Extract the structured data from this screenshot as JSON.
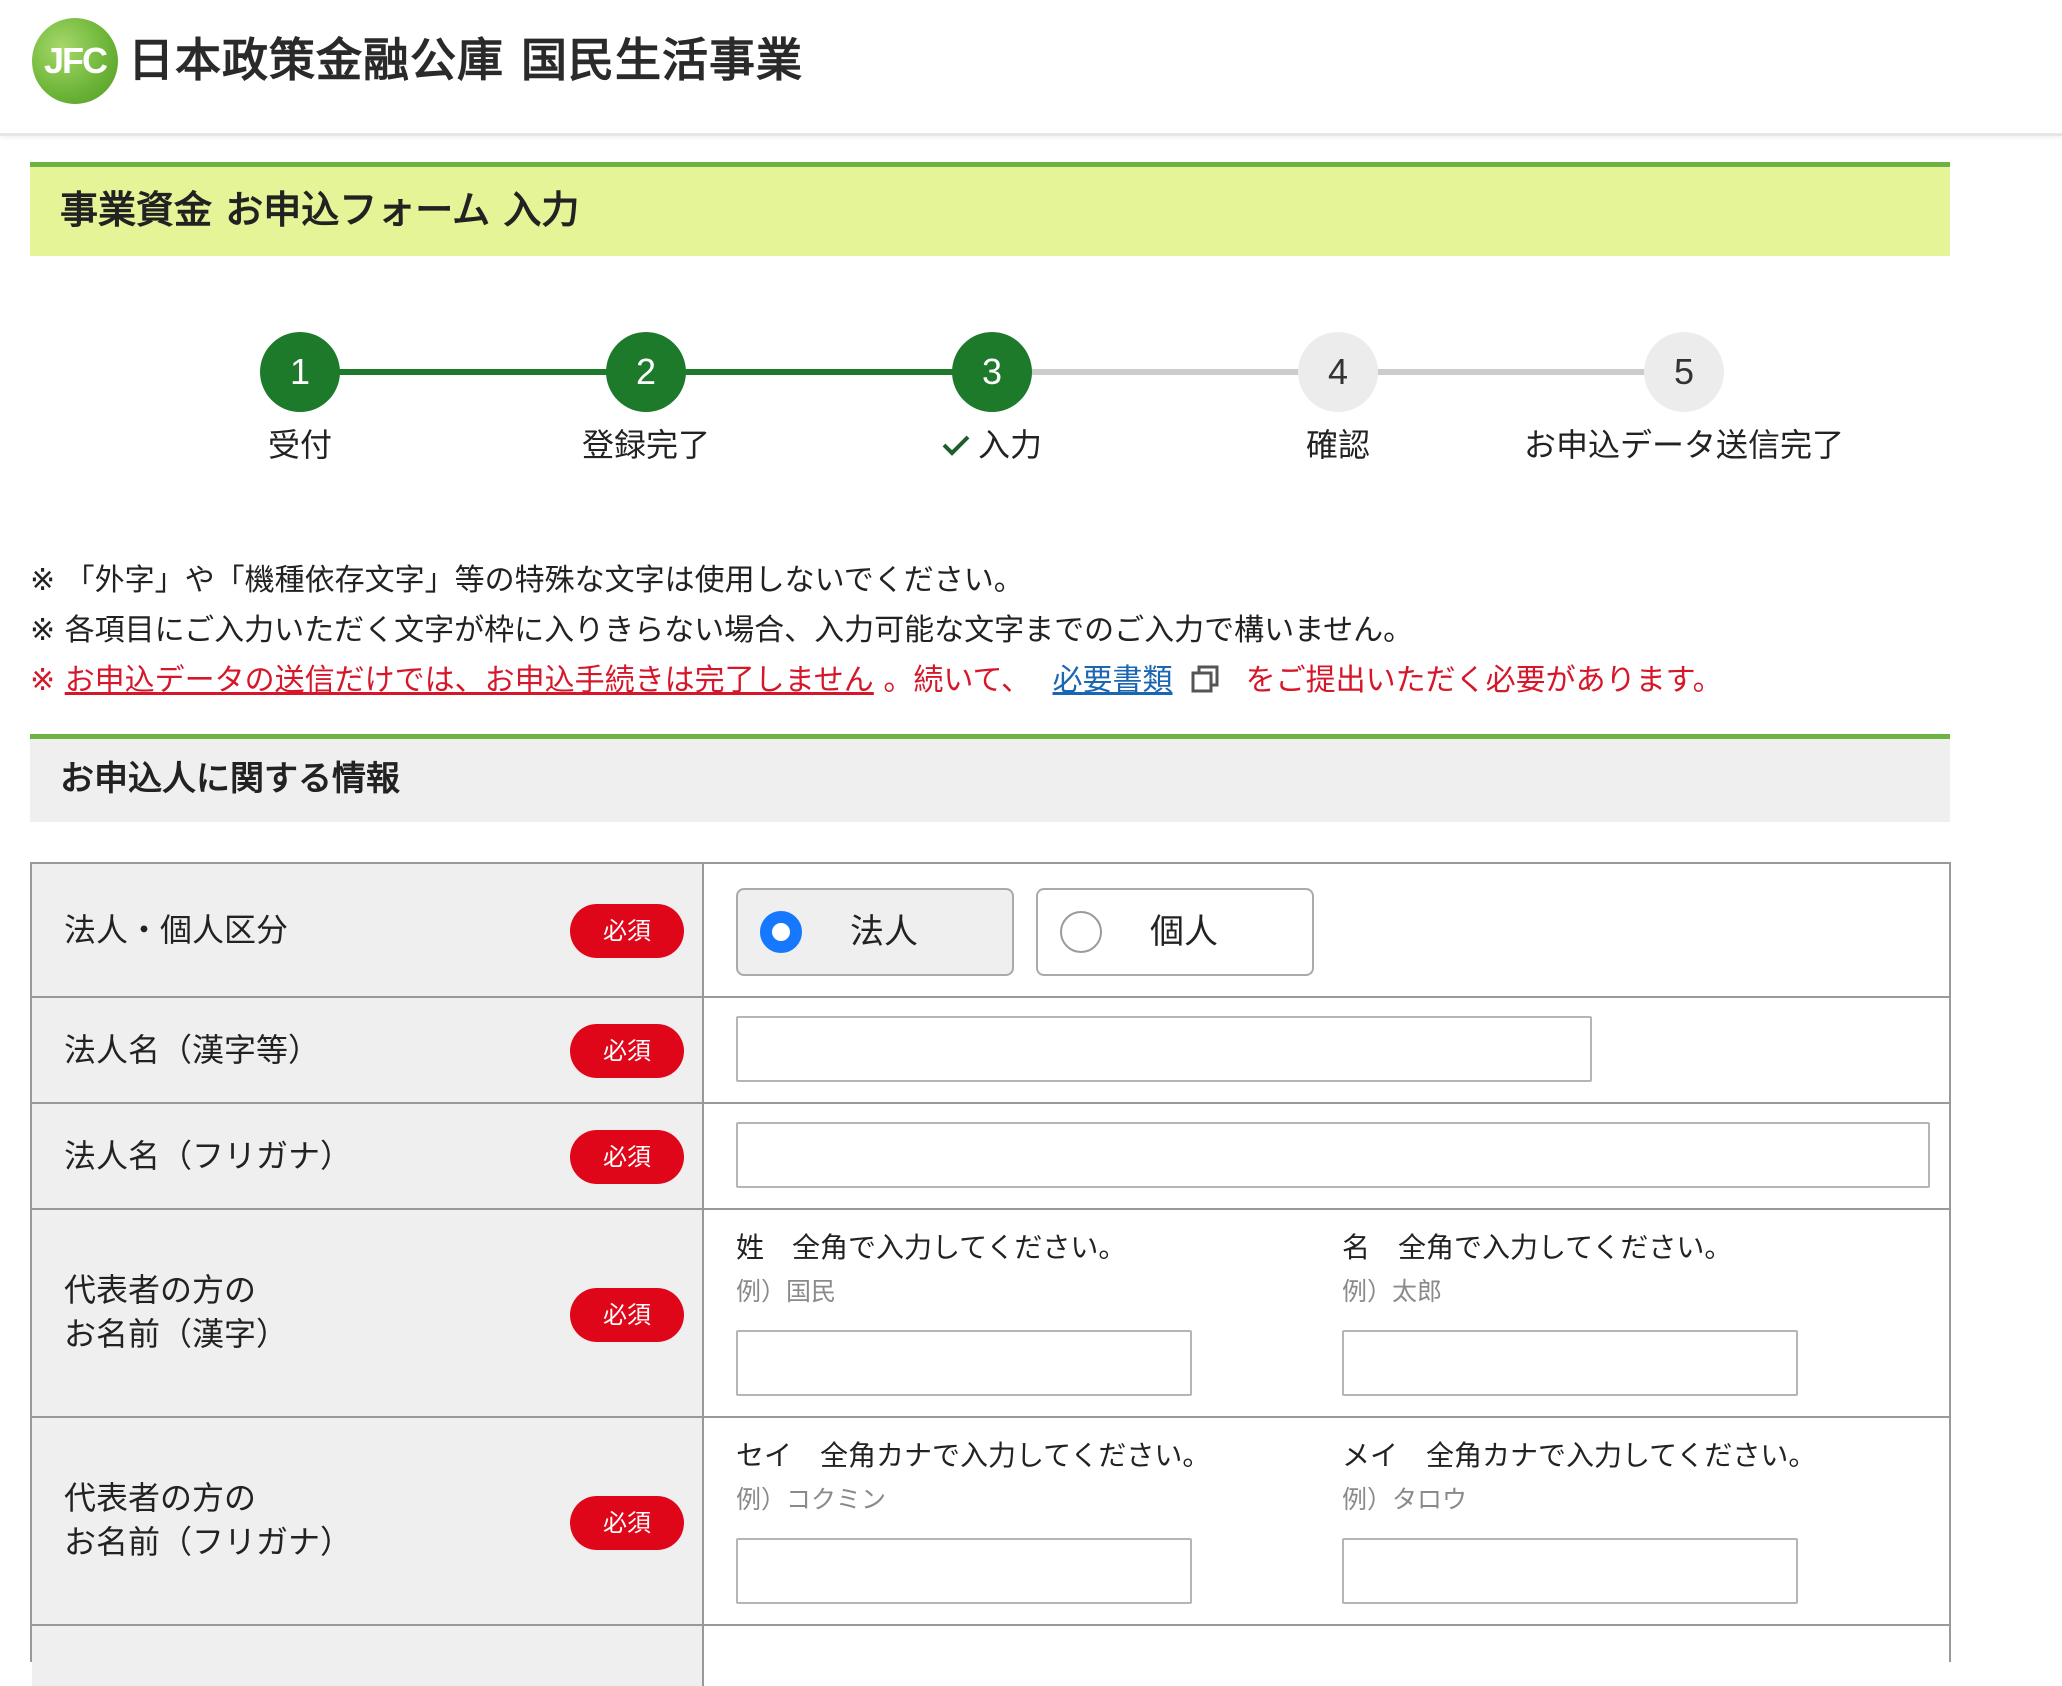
{
  "header": {
    "logo_mark": "JFC",
    "org_name": "日本政策金融公庫 国民生活事業"
  },
  "form_title": "事業資金 お申込フォーム 入力",
  "stepper": {
    "steps": [
      {
        "number": "1",
        "label": "受付",
        "status": "done"
      },
      {
        "number": "2",
        "label": "登録完了",
        "status": "done"
      },
      {
        "number": "3",
        "label": "入力",
        "status": "current"
      },
      {
        "number": "4",
        "label": "確認",
        "status": "todo"
      },
      {
        "number": "5",
        "label": "お申込データ送信完了",
        "status": "todo"
      }
    ]
  },
  "notes": {
    "note1": "※ 「外字」や「機種依存文字」等の特殊な文字は使用しないでください。",
    "note2": "※ 各項目にご入力いただく文字が枠に入りきらない場合、入力可能な文字までのご入力で構いません。",
    "note3_prefix": "※ ",
    "note3_link": "お申込データの送信だけでは、お申込手続きは完了しません",
    "note3_middle": " 。続いて、",
    "note3_docs_link": "必要書類",
    "note3_suffix": "をご提出いただく必要があります。"
  },
  "section_title": "お申込人に関する情報",
  "required_badge": "必須",
  "fields": {
    "entity_type": {
      "label": "法人・個人区分",
      "options": [
        "法人",
        "個人"
      ],
      "selected": "法人"
    },
    "corp_name_kanji": {
      "label": "法人名（漢字等）",
      "value": ""
    },
    "corp_name_kana": {
      "label": "法人名（フリガナ）",
      "value": ""
    },
    "rep_name_kanji": {
      "label_line1": "代表者の方の",
      "label_line2": "お名前（漢字）",
      "last_label": "姓　全角で入力してください。",
      "last_example": "例）国民",
      "first_label": "名　全角で入力してください。",
      "first_example": "例）太郎",
      "last_value": "",
      "first_value": ""
    },
    "rep_name_kana": {
      "label_line1": "代表者の方の",
      "label_line2": "お名前（フリガナ）",
      "last_label": "セイ　全角カナで入力してください。",
      "last_example": "例）コクミン",
      "first_label": "メイ　全角カナで入力してください。",
      "first_example": "例）タロウ",
      "last_value": "",
      "first_value": ""
    }
  },
  "colors": {
    "brand_green": "#1d7a2b",
    "title_band": "#e4f496",
    "accent_line": "#6db33f",
    "required_red": "#e0061a",
    "warning_red": "#d6172a",
    "link_blue": "#1a66b3",
    "radio_blue": "#1677ff"
  }
}
